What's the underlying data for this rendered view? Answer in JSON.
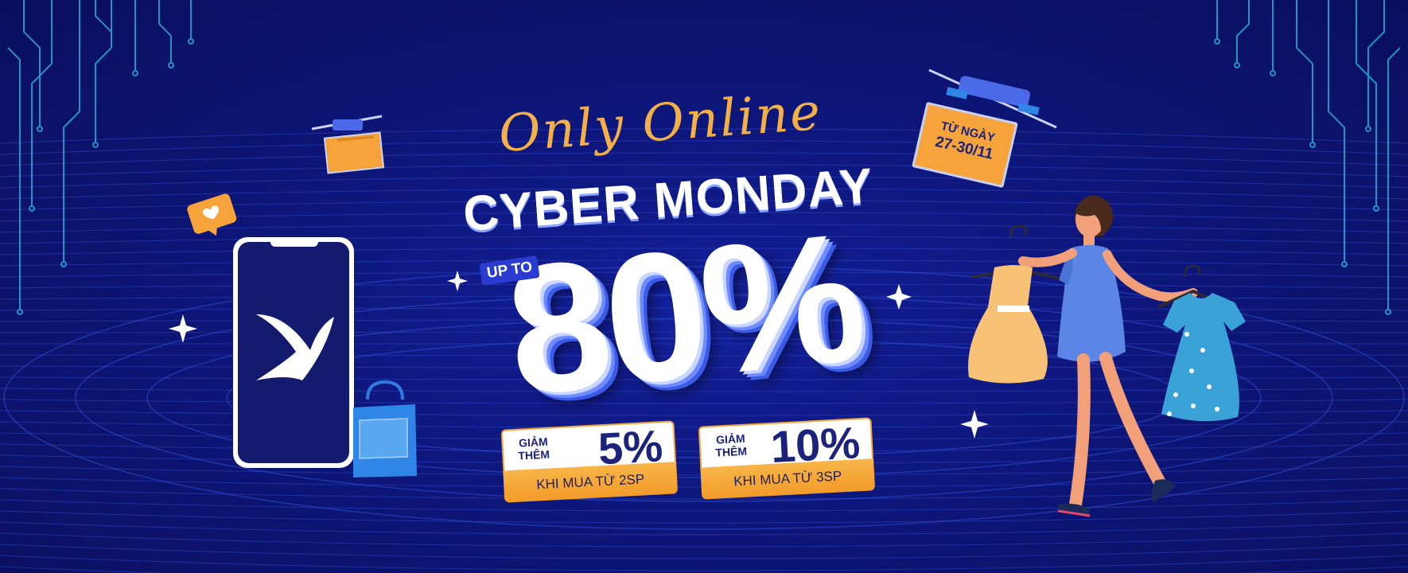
{
  "banner": {
    "script_title": "Only Online",
    "title": "CYBER MONDAY",
    "up_to": "UP TO",
    "discount": "80%",
    "colors": {
      "background": "#0d167a",
      "accent_orange": "#f4a33a",
      "white": "#ffffff",
      "navy": "#1b237a"
    }
  },
  "date_sign": {
    "line1": "TỪ NGÀY",
    "line2": "27-30/11"
  },
  "tickets": [
    {
      "line1": "GIẢM",
      "line2": "THÊM",
      "value": "5%",
      "condition": "KHI MUA TỪ 2SP"
    },
    {
      "line1": "GIẢM",
      "line2": "THÊM",
      "value": "10%",
      "condition": "KHI MUA TỪ 3SP"
    }
  ],
  "icons": [
    "phone-icon",
    "brand-logo-icon",
    "heart-bubble-icon",
    "shopping-bag-icon",
    "drone-box-icon",
    "drone-sign-icon",
    "sparkle-icon",
    "woman-shopper-illustration",
    "yellow-dress-icon",
    "blue-dress-icon"
  ]
}
